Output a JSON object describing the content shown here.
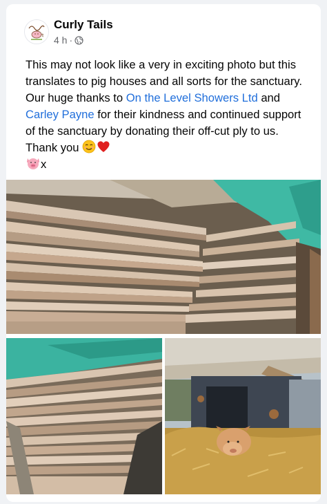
{
  "post": {
    "author": "Curly Tails",
    "time_ago": "4 h",
    "separator": "·",
    "avatar_text_top": "Curly Tails",
    "avatar_text_bottom": "Pig Sanctuary",
    "text_part1": "This may not look like a very in exciting photo but this translates to pig houses and all sorts for the sanctuary. Our huge thanks to ",
    "link1": "On the Level Showers Ltd",
    "text_part2": " and ",
    "link2": "Carley Payne",
    "text_part3": " for their kindness and continued support of the sanctuary by donating their off-cut ply to us. Thank you ",
    "text_part4": "x"
  },
  "icons": {
    "privacy": "globe-icon",
    "emoji1": "smiling-face-icon",
    "emoji2": "red-heart-icon",
    "emoji3": "pig-face-icon"
  },
  "colors": {
    "link": "#216fdb",
    "meta": "#65676b",
    "background": "#f0f2f5"
  }
}
